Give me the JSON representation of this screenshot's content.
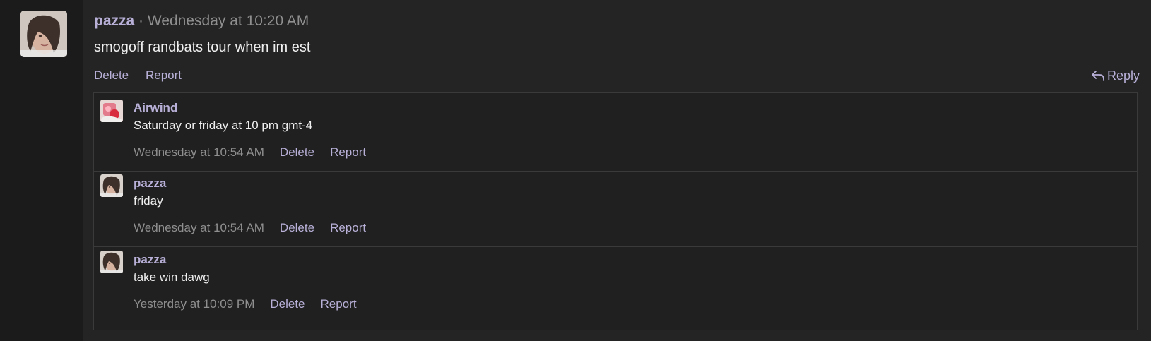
{
  "post": {
    "author": "pazza",
    "separator": "·",
    "timestamp": "Wednesday at 10:20 AM",
    "body": "smogoff randbats tour when im est",
    "actions": {
      "delete": "Delete",
      "report": "Report",
      "reply": "Reply"
    }
  },
  "replies": [
    {
      "author": "Airwind",
      "text": "Saturday or friday at 10 pm gmt-4",
      "timestamp": "Wednesday at 10:54 AM",
      "delete": "Delete",
      "report": "Report"
    },
    {
      "author": "pazza",
      "text": "friday",
      "timestamp": "Wednesday at 10:54 AM",
      "delete": "Delete",
      "report": "Report"
    },
    {
      "author": "pazza",
      "text": "take win dawg",
      "timestamp": "Yesterday at 10:09 PM",
      "delete": "Delete",
      "report": "Report"
    }
  ],
  "colors": {
    "background": "#232323",
    "left_rail": "#1b1b1b",
    "accent": "#b9b0d8",
    "muted": "#8f8f8f",
    "text": "#efefef",
    "border": "#3a3a3a"
  }
}
